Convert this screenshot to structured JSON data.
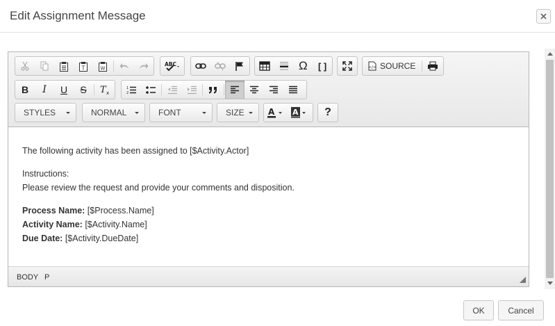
{
  "dialog": {
    "title": "Edit Assignment Message",
    "close_label": "×"
  },
  "toolbar": {
    "source_label": "SOURCE",
    "styles_label": "STYLES",
    "format_label": "NORMAL",
    "font_label": "FONT",
    "size_label": "SIZE",
    "help_label": "?",
    "omega_label": "Ω",
    "template_label": "[ ]",
    "spell_label": "ABC"
  },
  "content": {
    "line1": "The following activity has been assigned to [$Activity.Actor]",
    "instructions_label": "Instructions:",
    "instructions_text": "Please review the request and provide your comments and disposition.",
    "process_label": "Process Name:",
    "process_value": " [$Process.Name]",
    "activity_label": "Activity Name:",
    "activity_value": " [$Activity.Name]",
    "due_label": "Due Date:",
    "due_value": " [$Activity.DueDate]"
  },
  "statusbar": {
    "path": [
      "BODY",
      "P"
    ]
  },
  "footer": {
    "ok_label": "OK",
    "cancel_label": "Cancel"
  },
  "colors": {
    "toolbar_bg": "#efefef",
    "border": "#b6b6b6",
    "text": "#333333"
  }
}
